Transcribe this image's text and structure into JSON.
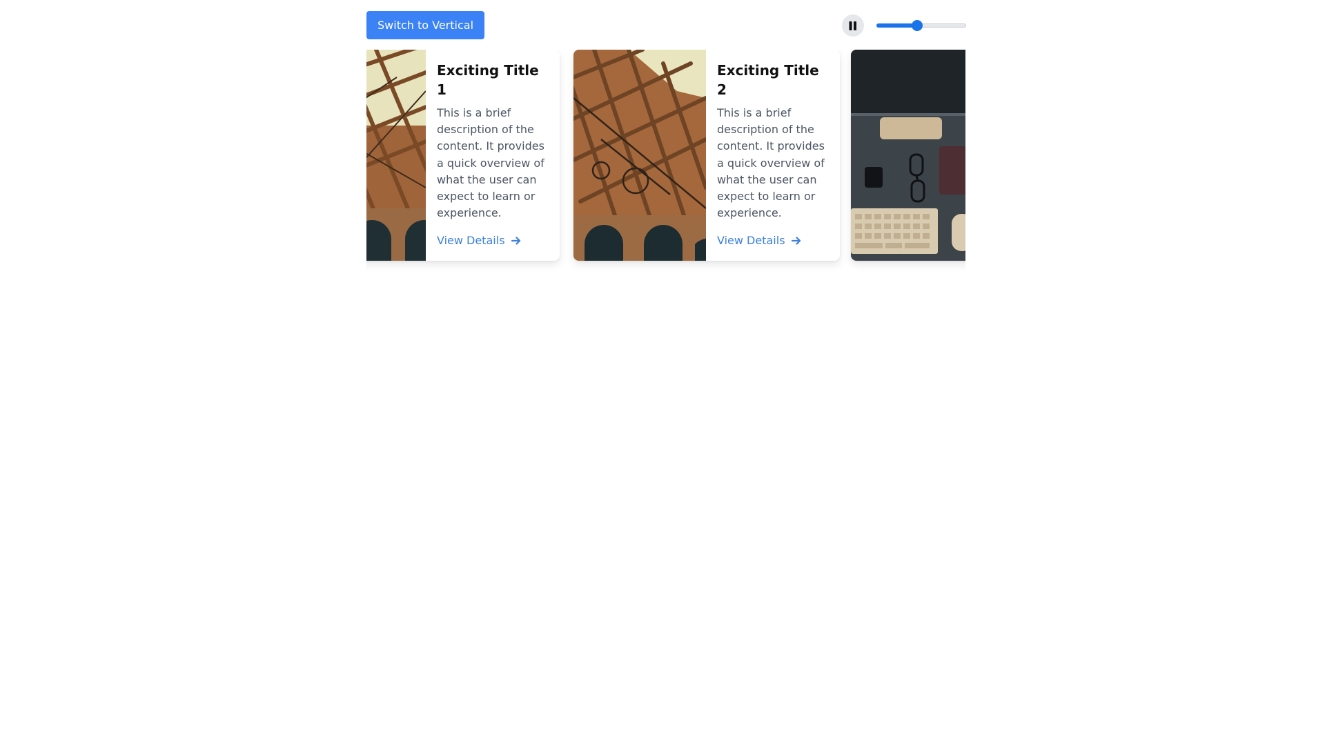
{
  "toolbar": {
    "switch_label": "Switch to Vertical",
    "pause_icon": "pause-icon",
    "speed_slider": {
      "value_fraction": 0.45,
      "accent": "#1a73e8"
    }
  },
  "cards": [
    {
      "title": "Exciting Title 1",
      "description": "This is a brief description of the content. It provides a quick overview of what the user can expect to learn or experience.",
      "link_label": "View Details",
      "image": "bridge-photo"
    },
    {
      "title": "Exciting Title 2",
      "description": "This is a brief description of the content. It provides a quick overview of what the user can expect to learn or experience.",
      "link_label": "View Details",
      "image": "bridge-photo"
    },
    {
      "title": "",
      "description": "",
      "link_label": "",
      "image": "desk-keyboard-photo"
    }
  ],
  "colors": {
    "button": "#3b82f6",
    "link": "#3b7fe0",
    "title": "#111111",
    "body_text": "#4b5563"
  }
}
